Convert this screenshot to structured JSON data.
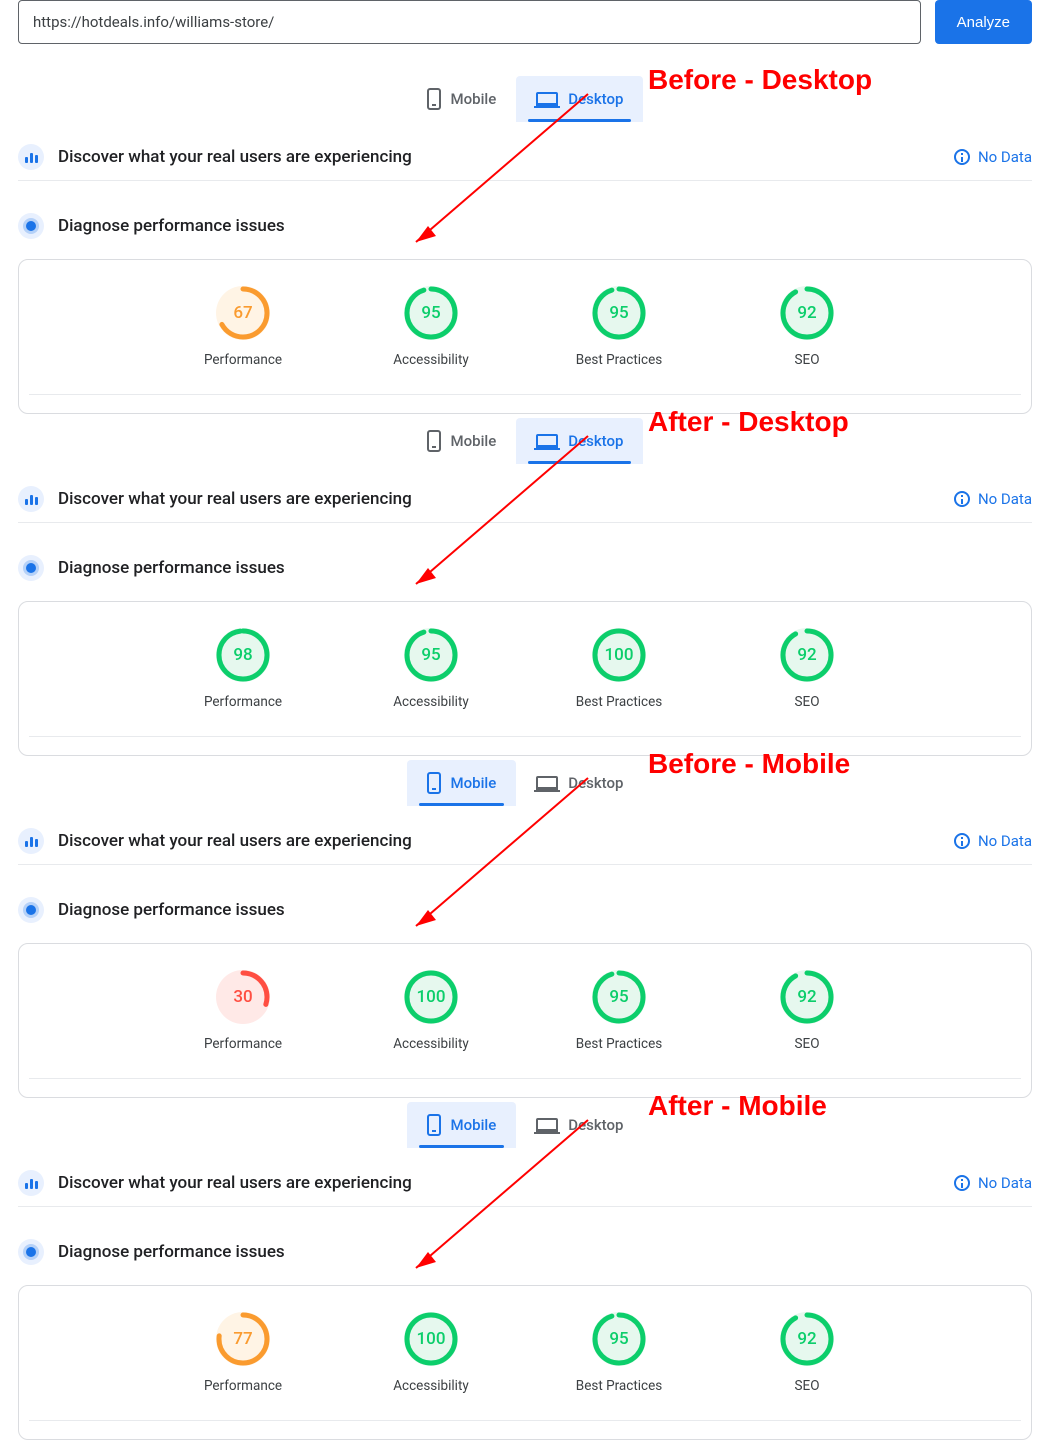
{
  "url_input": "https://hotdeals.info/williams-store/",
  "analyze_button": "Analyze",
  "tabs": {
    "mobile": "Mobile",
    "desktop": "Desktop"
  },
  "sections": {
    "crux": "Discover what your real users are experiencing",
    "diag": "Diagnose performance issues",
    "no_data": "No Data"
  },
  "metric_labels": {
    "performance": "Performance",
    "accessibility": "Accessibility",
    "best_practices": "Best Practices",
    "seo": "SEO"
  },
  "annotations": {
    "before_desktop": "Before - Desktop",
    "after_desktop": "After - Desktop",
    "before_mobile": "Before - Mobile",
    "after_mobile": "After - Mobile"
  },
  "chart_data": [
    {
      "type": "table",
      "title": "Lighthouse scores – Before Desktop",
      "categories": [
        "Performance",
        "Accessibility",
        "Best Practices",
        "SEO"
      ],
      "values": [
        67,
        95,
        95,
        92
      ],
      "colors": [
        "orange",
        "green",
        "green",
        "green"
      ]
    },
    {
      "type": "table",
      "title": "Lighthouse scores – After Desktop",
      "categories": [
        "Performance",
        "Accessibility",
        "Best Practices",
        "SEO"
      ],
      "values": [
        98,
        95,
        100,
        92
      ],
      "colors": [
        "green",
        "green",
        "green",
        "green"
      ]
    },
    {
      "type": "table",
      "title": "Lighthouse scores – Before Mobile",
      "categories": [
        "Performance",
        "Accessibility",
        "Best Practices",
        "SEO"
      ],
      "values": [
        30,
        100,
        95,
        92
      ],
      "colors": [
        "red",
        "green",
        "green",
        "green"
      ]
    },
    {
      "type": "table",
      "title": "Lighthouse scores – After Mobile",
      "categories": [
        "Performance",
        "Accessibility",
        "Best Practices",
        "SEO"
      ],
      "values": [
        77,
        100,
        95,
        92
      ],
      "colors": [
        "orange",
        "green",
        "green",
        "green"
      ]
    }
  ]
}
